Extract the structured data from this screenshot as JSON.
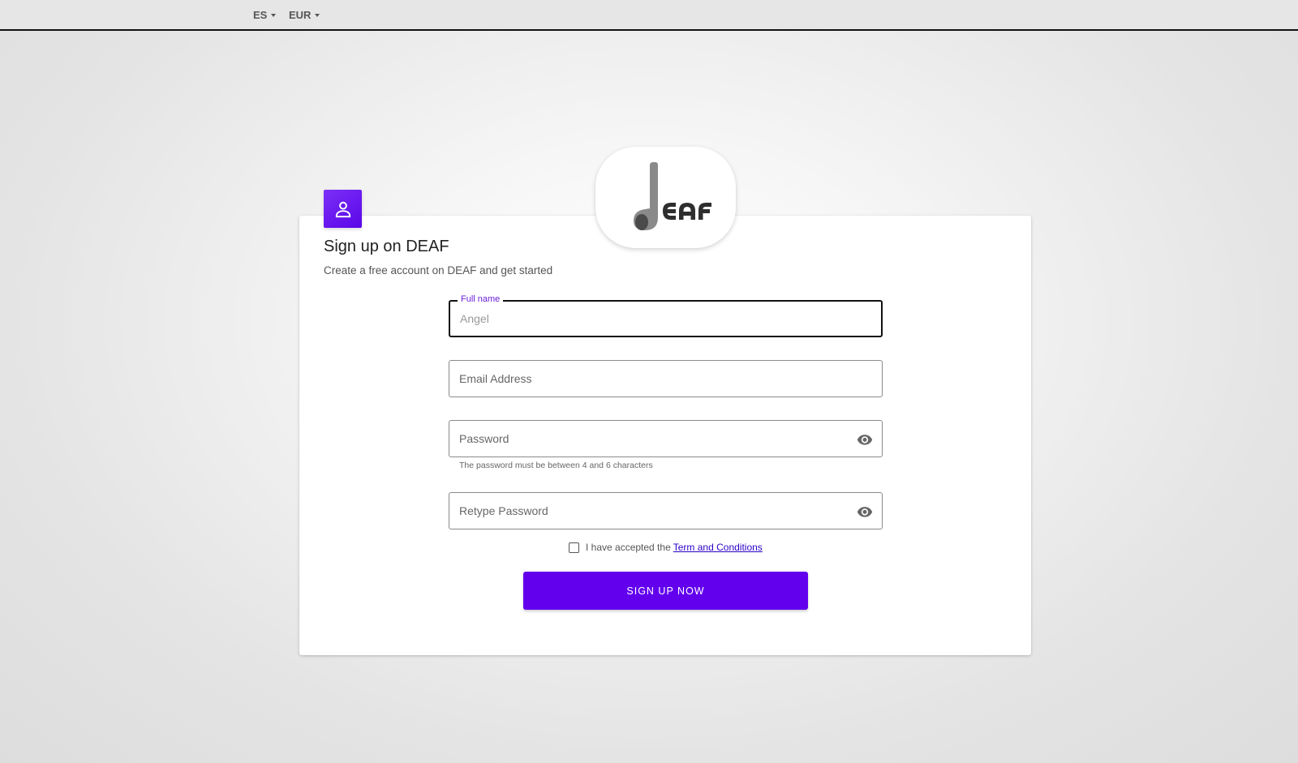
{
  "topbar": {
    "language": "ES",
    "currency": "EUR"
  },
  "brand": {
    "logo_text": "DEAF",
    "accent_color": "#6200ee"
  },
  "header": {
    "title": "Sign up on DEAF",
    "subtitle": "Create a free account on DEAF and get started"
  },
  "form": {
    "full_name": {
      "label": "Full name",
      "placeholder": "Angel",
      "value": ""
    },
    "email": {
      "placeholder": "Email Address"
    },
    "password": {
      "placeholder": "Password",
      "hint": "The password must be between 4 and 6 characters"
    },
    "retype_password": {
      "placeholder": "Retype Password"
    },
    "terms": {
      "checked": false,
      "text": "I have accepted the",
      "link": "Term and Conditions"
    },
    "submit_label": "SIGN UP NOW"
  },
  "icons": {
    "user": "user-icon",
    "visibility": "eye-icon",
    "dropdown": "caret-down-icon"
  }
}
